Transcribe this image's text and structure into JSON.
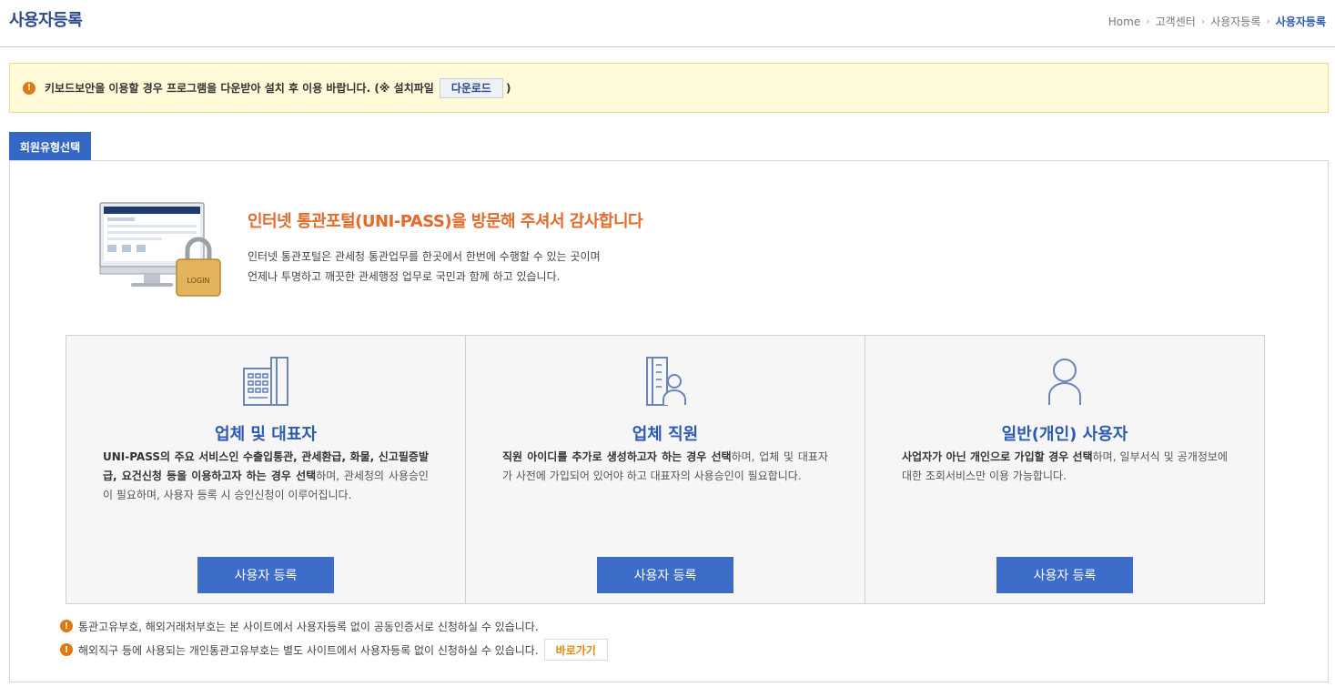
{
  "header": {
    "title": "사용자등록",
    "breadcrumb": [
      "Home",
      "고객센터",
      "사용자등록",
      "사용자등록"
    ]
  },
  "notice": {
    "text": "키보드보안을 이용할 경우 프로그램을 다운받아 설치 후 이용 바랍니다. (※ 설치파일",
    "download_label": "다운로드",
    "close_paren": ")"
  },
  "tab": {
    "label": "회원유형선택"
  },
  "intro": {
    "title": "인터넷 통관포털(UNI-PASS)을 방문해 주셔서 감사합니다",
    "line1": "인터넷 통관포털은 관세청 통관업무를 한곳에서 한번에 수행할 수 있는 곳이며",
    "line2": "언제나 투명하고 깨끗한 관세행정 업무로 국민과 함께 하고 있습니다.",
    "lock_label": "LOGIN"
  },
  "cards": [
    {
      "icon": "building-icon",
      "title": "업체 및 대표자",
      "desc_bold": "UNI-PASS의 주요 서비스인 수출입통관, 관세환급, 화물, 신고필증발급, 요건신청 등을 이용하고자 하는 경우 선택",
      "desc_rest": "하며, 관세청의 사용승인이 필요하며, 사용자 등록 시 승인신청이 이루어집니다.",
      "button": "사용자 등록"
    },
    {
      "icon": "employee-icon",
      "title": "업체 직원",
      "desc_bold": "직원 아이디를 추가로 생성하고자 하는 경우 선택",
      "desc_rest": "하며, 업체 및 대표자가 사전에 가입되어 있어야 하고 대표자의 사용승인이 필요합니다.",
      "button": "사용자 등록"
    },
    {
      "icon": "person-icon",
      "title": "일반(개인) 사용자",
      "desc_bold": "사업자가 아닌 개인으로 가입할 경우 선택",
      "desc_rest": "하며, 일부서식 및 공개정보에 대한 조회서비스만 이용 가능합니다.",
      "button": "사용자 등록"
    }
  ],
  "notes": {
    "note1": "통관고유부호, 해외거래처부호는 본 사이트에서 사용자등록 없이 공동인증서로 신청하실 수 있습니다.",
    "note2": "해외직구 등에 사용되는 개인통관고유부호는 별도 사이트에서 사용자등록 없이 신청하실 수 있습니다.",
    "shortcut_label": "바로가기"
  },
  "colors": {
    "accent": "#3568c4",
    "title_orange": "#e36a2a",
    "warning": "#e07a10",
    "notice_bg": "#fffbd9"
  }
}
